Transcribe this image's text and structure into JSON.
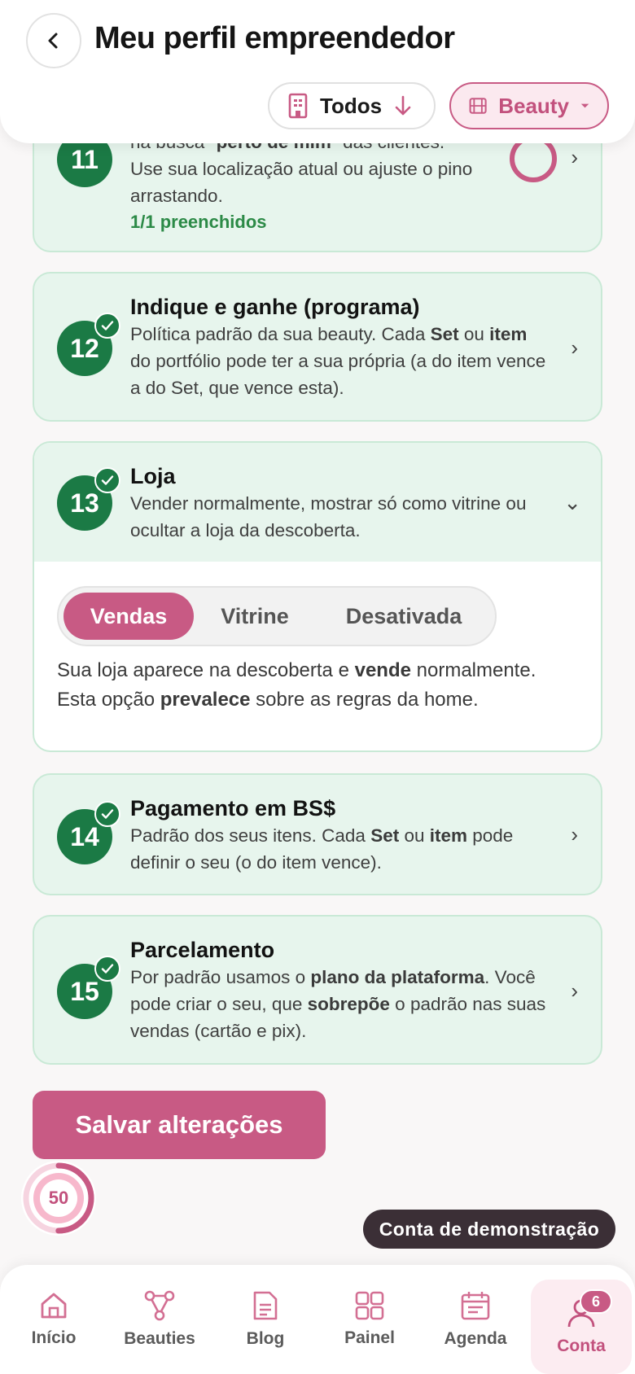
{
  "header": {
    "title": "Meu perfil empreendedor",
    "filters": {
      "todos_label": "Todos",
      "beauty_label": "Beauty"
    }
  },
  "cards": {
    "c11": {
      "number": "11",
      "desc_top_a": "na busca \"",
      "desc_top_b": "perto de mim",
      "desc_top_c": "\" das clientes.",
      "desc_1": "Use sua localização atual ou ajuste o pino",
      "desc_2": "arrastando.",
      "meta": "1/1 preenchidos"
    },
    "c12": {
      "number": "12",
      "title": "Indique e ganhe (programa)",
      "d1": "Política padrão da sua beauty. Cada ",
      "d2": "Set",
      "d3": " ou ",
      "d4": "item",
      "d5": "do portfólio pode ter a sua própria (a do item vence",
      "d6": "a do Set, que vence esta)."
    },
    "c13": {
      "number": "13",
      "title": "Loja",
      "d1": "Vender normalmente, mostrar só como vitrine ou",
      "d2": "ocultar a loja da descoberta.",
      "options": [
        "Vendas",
        "Vitrine",
        "Desativada"
      ],
      "selected": "Vendas",
      "info_1": "Sua loja aparece na descoberta e ",
      "info_2": "vende",
      "info_3": " normalmente.",
      "info_4": "Esta opção ",
      "info_5": "prevalece",
      "info_6": " sobre as regras da home."
    },
    "c14": {
      "number": "14",
      "title": "Pagamento em BS$",
      "d1": "Padrão dos seus itens. Cada ",
      "d2": "Set",
      "d3": " ou ",
      "d4": "item",
      "d5": " pode",
      "d6": "definir o seu (o do item vence)."
    },
    "c15": {
      "number": "15",
      "title": "Parcelamento",
      "d1": "Por padrão usamos o ",
      "d2": "plano da plataforma",
      "d3": ". Você",
      "d4": "pode criar o seu, que ",
      "d5": "sobrepõe",
      "d6": " o padrão nas suas",
      "d7": "vendas (cartão e pix)."
    }
  },
  "save_label": "Salvar alterações",
  "progress": {
    "value": 50,
    "fraction": 0.5
  },
  "demo_label": "Conta de demonstração",
  "nav": {
    "items": [
      {
        "label": "Início",
        "icon": "home-icon"
      },
      {
        "label": "Beauties",
        "icon": "network-icon"
      },
      {
        "label": "Blog",
        "icon": "document-icon"
      },
      {
        "label": "Painel",
        "icon": "grid-icon"
      },
      {
        "label": "Agenda",
        "icon": "calendar-icon"
      },
      {
        "label": "Conta",
        "icon": "user-icon",
        "badge": "6",
        "active": true
      }
    ]
  },
  "colors": {
    "brand": "#c85a84",
    "success": "#1b7a45",
    "card_bg": "#e7f5ed"
  }
}
